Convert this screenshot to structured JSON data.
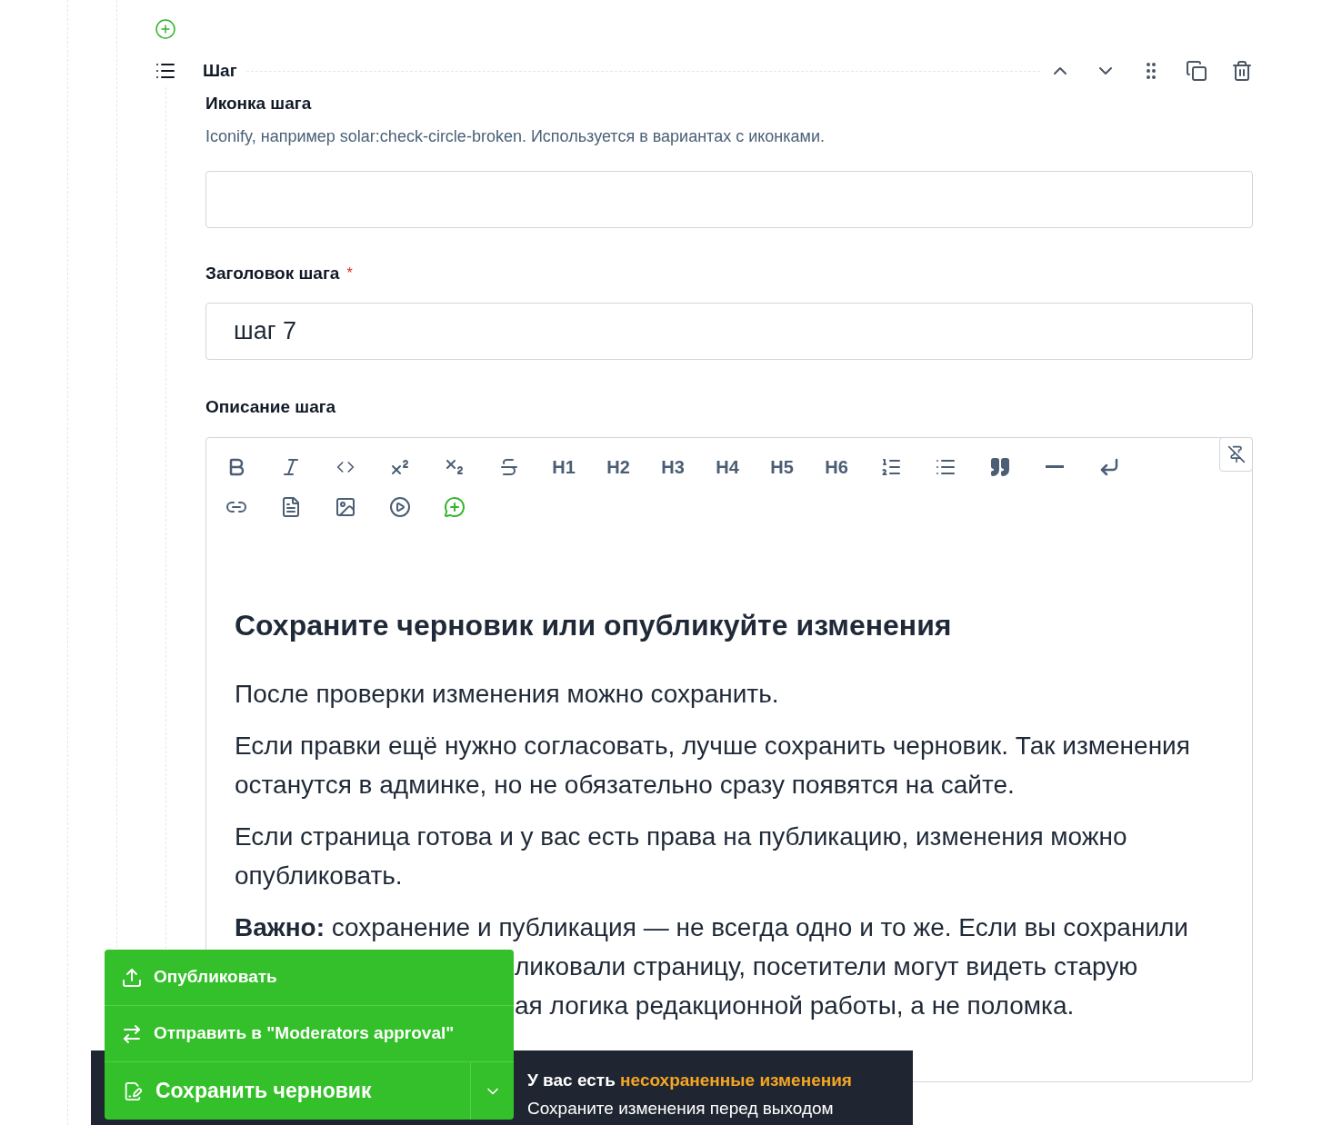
{
  "step": {
    "title": "Шаг"
  },
  "fields": [
    {
      "kind": "input",
      "label": "Иконка шага",
      "hint": "Iconify, например solar:check-circle-broken. Используется в вариантах с иконками."
    },
    {
      "kind": "input",
      "label": "Заголовок шага",
      "required_mark": "*",
      "value": "шаг 7"
    }
  ],
  "editor": {
    "label": "Описание шага",
    "headings": [
      "H1",
      "H2",
      "H3",
      "H4",
      "H5",
      "H6"
    ],
    "heading": "Сохраните черновик или опубликуйте изменения",
    "paragraphs": [
      "После проверки изменения можно сохранить.",
      "Если правки ещё нужно согласовать, лучше сохранить черновик. Так изменения останутся в админке, но не обязательно сразу появятся на сайте.",
      "Если страница готова и у вас есть права на публикацию, изменения можно опубликовать."
    ],
    "partly_covered": [
      "**Важно:** сохранение и публикация — не всегда одно и то же. Если вы сохранили",
      "ликовали страницу, посетители могут видеть старую",
      "ая логика редакционной работы, а не поломка."
    ]
  },
  "publish_menu": {
    "items": [
      {
        "kind": "upload",
        "label": "Опубликовать"
      },
      {
        "kind": "transfer",
        "label": "Отправить в \"Moderators approval\""
      }
    ],
    "main_button": "Сохранить черновик",
    "expanded": true
  },
  "notice": {
    "text_start": "У вас есть",
    "highlight": "несохраненные изменения",
    "subtitle": "Сохраните изменения перед выходом"
  }
}
